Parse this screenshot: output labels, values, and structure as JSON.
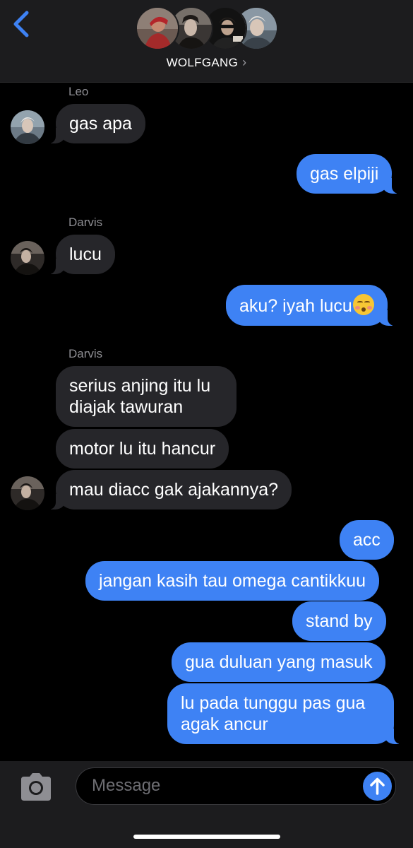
{
  "header": {
    "group_name": "WOLFGANG",
    "chevron": "›",
    "back_icon": "chevron-left-icon",
    "accent": "#3e82f4"
  },
  "messages": [
    {
      "sender": "Leo",
      "direction": "incoming",
      "text": "gas apa"
    },
    {
      "direction": "outgoing",
      "text": "gas elpiji"
    },
    {
      "sender": "Darvis",
      "direction": "incoming",
      "text": "lucu"
    },
    {
      "direction": "outgoing",
      "text": "aku? iyah lucu",
      "emoji": "kissing-closed-eyes-emoji"
    },
    {
      "sender": "Darvis",
      "direction": "incoming",
      "text": "serius anjing itu lu diajak tawuran"
    },
    {
      "direction": "incoming",
      "text": "motor lu itu hancur"
    },
    {
      "direction": "incoming",
      "text": "mau diacc gak ajakannya?"
    },
    {
      "direction": "outgoing",
      "text": "acc"
    },
    {
      "direction": "outgoing",
      "text": "jangan kasih tau omega cantikkuu"
    },
    {
      "direction": "outgoing",
      "text": "stand by"
    },
    {
      "direction": "outgoing",
      "text": "gua duluan yang masuk"
    },
    {
      "direction": "outgoing",
      "text": "lu pada tunggu pas gua agak ancur"
    }
  ],
  "input": {
    "placeholder": "Message",
    "camera_icon": "camera-icon",
    "send_icon": "arrow-up-icon"
  },
  "colors": {
    "incoming_bubble": "#26262a",
    "outgoing_bubble": "#3e82f4",
    "background": "#000000",
    "bar": "#1c1c1e"
  }
}
